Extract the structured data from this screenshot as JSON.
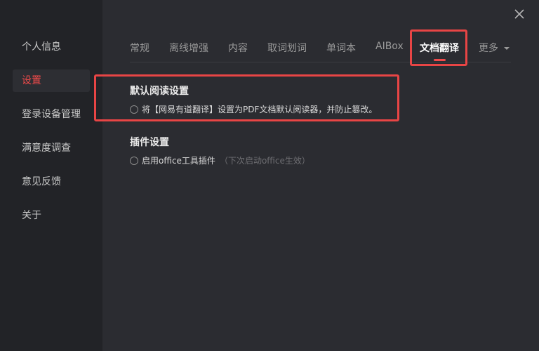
{
  "sidebar": {
    "items": [
      {
        "label": "个人信息"
      },
      {
        "label": "设置"
      },
      {
        "label": "登录设备管理"
      },
      {
        "label": "满意度调查"
      },
      {
        "label": "意见反馈"
      },
      {
        "label": "关于"
      }
    ],
    "active_index": 1
  },
  "tabs": [
    {
      "label": "常规"
    },
    {
      "label": "离线增强"
    },
    {
      "label": "内容"
    },
    {
      "label": "取词划词"
    },
    {
      "label": "单词本"
    },
    {
      "label": "AIBox"
    },
    {
      "label": "文档翻译"
    },
    {
      "label": "更多"
    }
  ],
  "sections": {
    "default_reader": {
      "title": "默认阅读设置",
      "option": "将【网易有道翻译】设置为PDF文档默认阅读器，并防止篡改。"
    },
    "plugins": {
      "title": "插件设置",
      "option": "启用office工具插件",
      "hint": "（下次启动office生效）"
    }
  },
  "colors": {
    "accent": "#f04a4a",
    "highlight_box": "#e84545",
    "background": "#2b2c31",
    "sidebar": "#222327"
  },
  "icons": {
    "close": "close-icon",
    "more": "caret-down-icon"
  }
}
